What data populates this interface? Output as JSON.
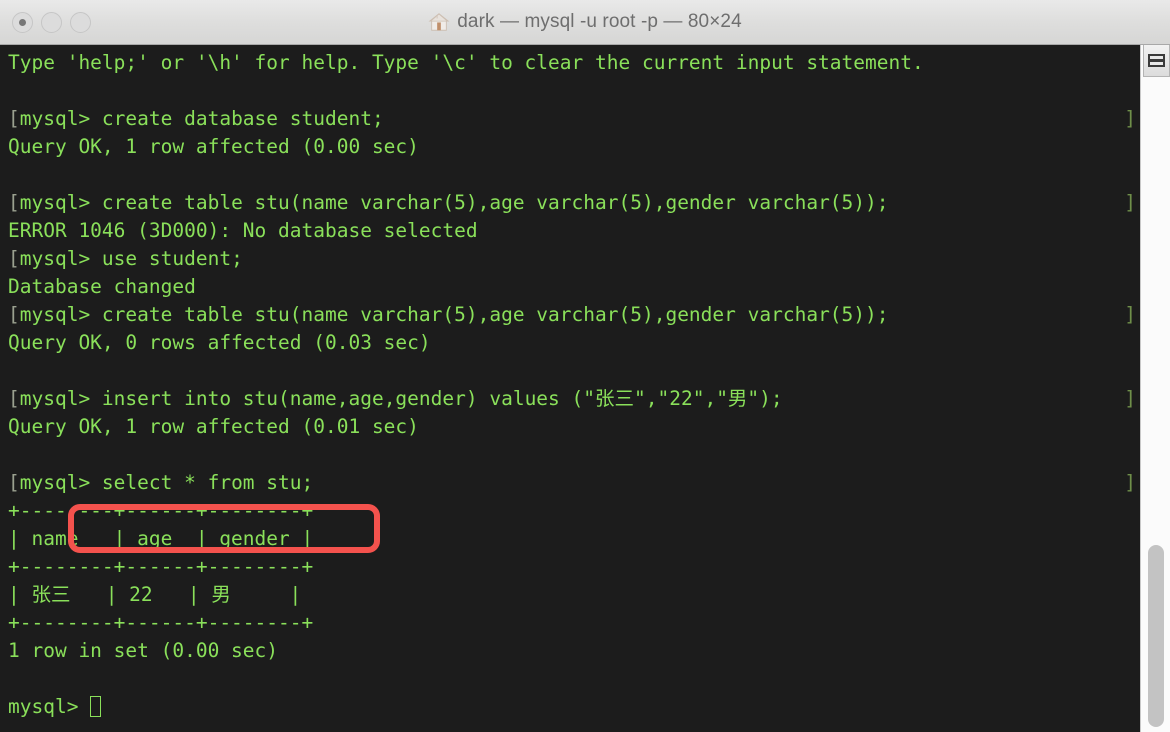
{
  "window": {
    "titlebar": {
      "icon": "home-icon",
      "title": "dark — mysql -u root -p — 80×24",
      "buttons": [
        {
          "name": "close-button",
          "label": "close"
        },
        {
          "name": "minimize-button",
          "label": "minimize"
        },
        {
          "name": "zoom-button",
          "label": "zoom"
        }
      ]
    },
    "theme": {
      "background": "#1c1c1c",
      "foreground": "#8ae05a",
      "mark": "#9aa08f",
      "annotation": "#f4524d",
      "titlebar_bg": "#dededd",
      "titlebar_text": "#6e6e6e"
    }
  },
  "terminal": {
    "columns": 80,
    "rows": 24,
    "cursor": "▯",
    "lines": [
      {
        "mark": "",
        "text": "Type 'help;' or '\\h' for help. Type '\\c' to clear the current input statement.",
        "endmark": false
      },
      {
        "mark": "",
        "text": "",
        "endmark": false
      },
      {
        "mark": "[",
        "text": "mysql> create database student;",
        "endmark": true
      },
      {
        "mark": "",
        "text": "Query OK, 1 row affected (0.00 sec)",
        "endmark": false
      },
      {
        "mark": "",
        "text": "",
        "endmark": false
      },
      {
        "mark": "[",
        "text": "mysql> create table stu(name varchar(5),age varchar(5),gender varchar(5));",
        "endmark": true
      },
      {
        "mark": "",
        "text": "ERROR 1046 (3D000): No database selected",
        "endmark": false
      },
      {
        "mark": "[",
        "text": "mysql> use student;",
        "endmark": false
      },
      {
        "mark": "",
        "text": "Database changed",
        "endmark": false
      },
      {
        "mark": "[",
        "text": "mysql> create table stu(name varchar(5),age varchar(5),gender varchar(5));",
        "endmark": true
      },
      {
        "mark": "",
        "text": "Query OK, 0 rows affected (0.03 sec)",
        "endmark": false
      },
      {
        "mark": "",
        "text": "",
        "endmark": false
      },
      {
        "mark": "[",
        "text": "mysql> insert into stu(name,age,gender) values (\"张三\",\"22\",\"男\");",
        "endmark": true
      },
      {
        "mark": "",
        "text": "Query OK, 1 row affected (0.01 sec)",
        "endmark": false
      },
      {
        "mark": "",
        "text": "",
        "endmark": false
      },
      {
        "mark": "[",
        "text": "mysql> select * from stu;",
        "endmark": true
      },
      {
        "mark": "",
        "text": "+--------+------+--------+",
        "endmark": false
      },
      {
        "mark": "",
        "text": "| name   | age  | gender |",
        "endmark": false
      },
      {
        "mark": "",
        "text": "+--------+------+--------+",
        "endmark": false
      },
      {
        "mark": "",
        "text": "| 张三   | 22   | 男     |",
        "endmark": false
      },
      {
        "mark": "",
        "text": "+--------+------+--------+",
        "endmark": false
      },
      {
        "mark": "",
        "text": "1 row in set (0.00 sec)",
        "endmark": false
      },
      {
        "mark": "",
        "text": "",
        "endmark": false
      },
      {
        "mark": "",
        "text": "mysql> ",
        "endmark": false,
        "cursor": true
      }
    ],
    "result_table": {
      "columns": [
        "name",
        "age",
        "gender"
      ],
      "rows": [
        [
          "张三",
          "22",
          "男"
        ]
      ],
      "footer": "1 row in set (0.00 sec)"
    }
  },
  "annotation": {
    "name": "red-highlight-box",
    "target_text": "> select * from stu;",
    "color": "#f4524d"
  },
  "scrollbar": {
    "top_button": "lines-icon",
    "thumb_label": "scroll-thumb"
  }
}
